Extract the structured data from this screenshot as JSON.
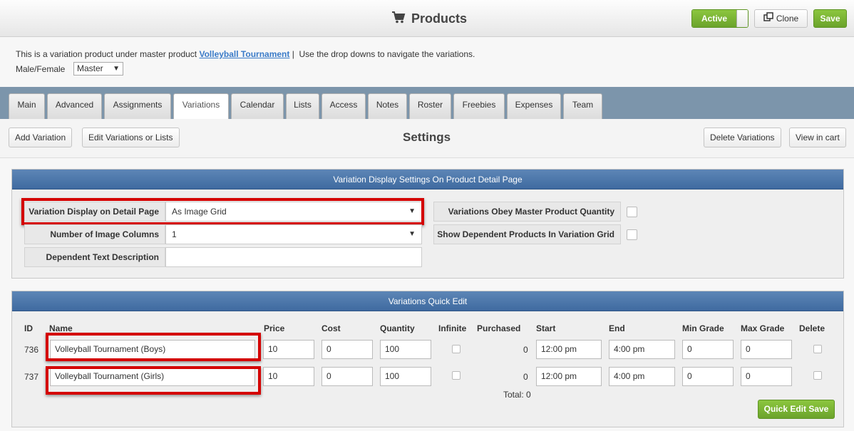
{
  "header": {
    "title": "Products",
    "active_label": "Active",
    "clone_label": "Clone",
    "save_label": "Save"
  },
  "info": {
    "prefix": "This is a variation product under master product",
    "master_link": "Volleyball Tournament",
    "suffix": "|  Use the drop downs to navigate the variations.",
    "selector_label": "Male/Female",
    "selector_value": "Master"
  },
  "tabs": [
    "Main",
    "Advanced",
    "Assignments",
    "Variations",
    "Calendar",
    "Lists",
    "Access",
    "Notes",
    "Roster",
    "Freebies",
    "Expenses",
    "Team"
  ],
  "toolbar": {
    "add_variation": "Add Variation",
    "edit_variations": "Edit Variations or Lists",
    "title": "Settings",
    "delete_variations": "Delete Variations",
    "view_in_cart": "View in cart"
  },
  "display_settings": {
    "heading": "Variation Display Settings On Product Detail Page",
    "display_label": "Variation Display on Detail Page",
    "display_value": "As Image Grid",
    "columns_label": "Number of Image Columns",
    "columns_value": "1",
    "dependent_label": "Dependent Text Description",
    "dependent_value": "",
    "obey_label": "Variations Obey Master Product Quantity",
    "obey_checked": false,
    "show_dependent_label": "Show Dependent Products In Variation Grid",
    "show_dependent_checked": false
  },
  "quick_edit": {
    "heading": "Variations Quick Edit",
    "columns": {
      "id": "ID",
      "name": "Name",
      "price": "Price",
      "cost": "Cost",
      "quantity": "Quantity",
      "infinite": "Infinite",
      "purchased": "Purchased",
      "start": "Start",
      "end": "End",
      "min_grade": "Min Grade",
      "max_grade": "Max Grade",
      "delete": "Delete"
    },
    "rows": [
      {
        "id": "736",
        "name": "Volleyball Tournament  (Boys)",
        "price": "10",
        "cost": "0",
        "quantity": "100",
        "infinite": false,
        "purchased": "0",
        "start": "12:00 pm",
        "end": "4:00 pm",
        "min_grade": "0",
        "max_grade": "0",
        "delete": false
      },
      {
        "id": "737",
        "name": "Volleyball Tournament  (Girls)",
        "price": "10",
        "cost": "0",
        "quantity": "100",
        "infinite": false,
        "purchased": "0",
        "start": "12:00 pm",
        "end": "4:00 pm",
        "min_grade": "0",
        "max_grade": "0",
        "delete": false
      }
    ],
    "total": "Total: 0",
    "save_label": "Quick Edit Save"
  },
  "colors": {
    "green": "#7ab434",
    "panel_header": "#4f79ad",
    "tab_bar": "#7c95ab",
    "highlight": "#d40000",
    "link": "#3a7bc8"
  },
  "icons": {
    "cart": "cart-icon",
    "clone": "clone-icon"
  }
}
